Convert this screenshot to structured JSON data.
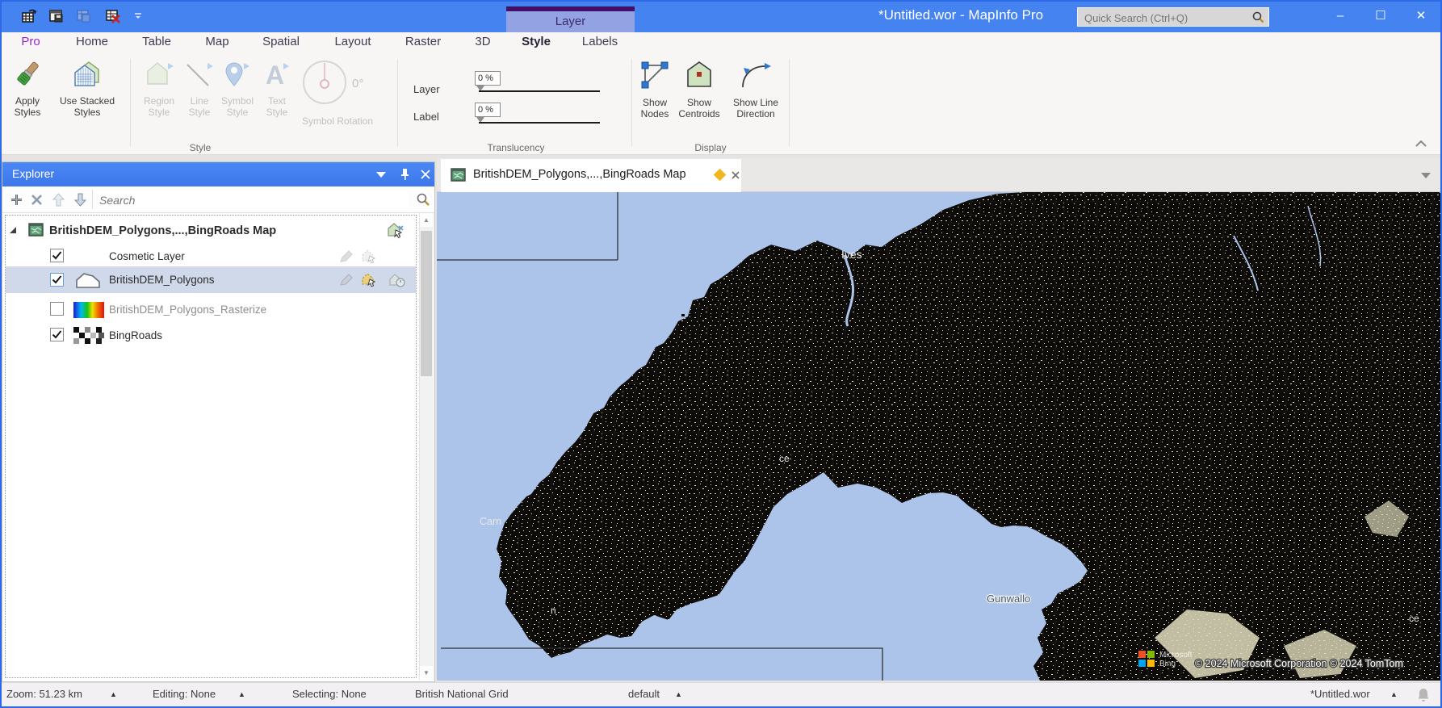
{
  "window": {
    "title": "*Untitled.wor - MapInfo Pro",
    "search_placeholder": "Quick Search (Ctrl+Q)",
    "controls": {
      "minimize": "–",
      "maximize": "☐",
      "close": "✕"
    }
  },
  "qat": {
    "icons": [
      "open-table",
      "save-workspace",
      "save-table",
      "close-table"
    ],
    "customize": "toolbar-options"
  },
  "ribbon": {
    "tabs": [
      {
        "label": "Pro"
      },
      {
        "label": "Home"
      },
      {
        "label": "Table"
      },
      {
        "label": "Map"
      },
      {
        "label": "Spatial"
      },
      {
        "label": "Layout"
      },
      {
        "label": "Raster"
      },
      {
        "label": "3D"
      }
    ],
    "contextual": {
      "group_label": "Layer",
      "tab_style": "Style",
      "tab_labels": "Labels",
      "active": "Style"
    },
    "style_group": {
      "group_label": "Style",
      "apply": "Apply Styles",
      "use_stacked": "Use Stacked Styles",
      "region": "Region Style",
      "line": "Line Style",
      "symbol": "Symbol Style",
      "text": "Text Style",
      "rotation": "Symbol Rotation",
      "rotation_value": "0°"
    },
    "translucency_group": {
      "group_label": "Translucency",
      "layer_label": "Layer",
      "label_label": "Label",
      "layer_value": "0 %",
      "label_value": "0 %"
    },
    "display_group": {
      "group_label": "Display",
      "nodes": "Show Nodes",
      "centroids": "Show Centroids",
      "line_direction": "Show Line Direction"
    }
  },
  "explorer": {
    "title": "Explorer",
    "search_placeholder": "Search",
    "map_name": "BritishDEM_Polygons,...,BingRoads Map",
    "layers": [
      {
        "label": "Cosmetic Layer",
        "checked": true
      },
      {
        "label": "BritishDEM_Polygons",
        "checked": true,
        "selected": true
      },
      {
        "label": "BritishDEM_Polygons_Rasterize",
        "checked": false
      },
      {
        "label": "BingRoads",
        "checked": true
      }
    ]
  },
  "document": {
    "tab_title": "BritishDEM_Polygons,...,BingRoads Map"
  },
  "map": {
    "labels": [
      {
        "text": "Ives",
        "kind": "land"
      },
      {
        "text": "ce",
        "kind": "land"
      },
      {
        "text": "Carn",
        "kind": "land"
      },
      {
        "text": "n",
        "kind": "land"
      },
      {
        "text": "Gunwallo",
        "kind": "sea"
      },
      {
        "text": "ce",
        "kind": "land"
      }
    ],
    "logo_line1": "Microsoft",
    "logo_line2": "Bing",
    "attribution": "© 2024 Microsoft Corporation © 2024 TomTom",
    "colors": {
      "sea": "#adc4ea",
      "land": "#0b0a08",
      "speckle": "#ece6cb"
    }
  },
  "status": {
    "zoom": "Zoom: 51.23 km",
    "editing": "Editing: None",
    "selecting": "Selecting: None",
    "projection": "British National Grid",
    "style": "default",
    "workspace": "*Untitled.wor"
  },
  "theme": {
    "titlebar_blue": "#4583f1",
    "contextual_purple": "#42106b",
    "accent_underline": "#4a86f0",
    "selection_row": "#cfd9ea",
    "diamond_yellow": "#f2b71e"
  }
}
